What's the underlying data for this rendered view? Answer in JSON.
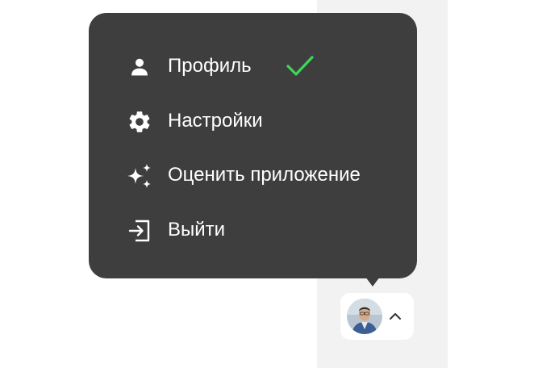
{
  "menu": {
    "items": [
      {
        "label": "Профиль",
        "icon": "person-icon",
        "selected": true
      },
      {
        "label": "Настройки",
        "icon": "gear-icon",
        "selected": false
      },
      {
        "label": "Оценить приложение",
        "icon": "sparkles-icon",
        "selected": false
      },
      {
        "label": "Выйти",
        "icon": "logout-icon",
        "selected": false
      }
    ],
    "selected_indicator": "checkmark-icon"
  },
  "user_button": {
    "avatar": "avatar",
    "chevron": "chevron-up-icon"
  },
  "colors": {
    "menu_background": "#3e3e3e",
    "menu_text": "#ffffff",
    "check": "#3ed65a",
    "side_panel": "#f2f2f2",
    "page_background": "#ffffff"
  }
}
